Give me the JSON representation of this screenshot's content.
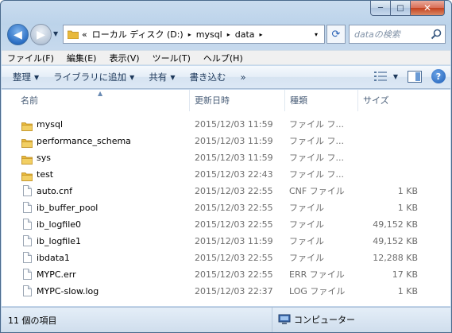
{
  "window": {
    "caption_buttons": {
      "minimize": "─",
      "maximize": "□",
      "close": "✕"
    }
  },
  "address": {
    "prefix": "«",
    "crumbs": [
      "ローカル ディスク (D:)",
      "mysql",
      "data"
    ],
    "separator": "▸",
    "dropdown": "▾",
    "refresh_icon": "refresh-icon"
  },
  "search": {
    "placeholder": "dataの検索"
  },
  "menu": [
    "ファイル(F)",
    "編集(E)",
    "表示(V)",
    "ツール(T)",
    "ヘルプ(H)"
  ],
  "commands": {
    "organize": "整理",
    "add_to_library": "ライブラリに追加",
    "share": "共有",
    "burn": "書き込む",
    "more": "»"
  },
  "columns": {
    "name": "名前",
    "date": "更新日時",
    "type": "種類",
    "size": "サイズ"
  },
  "files": [
    {
      "kind": "folder",
      "name": "mysql",
      "date": "2015/12/03 11:59",
      "type": "ファイル フ...",
      "size": ""
    },
    {
      "kind": "folder",
      "name": "performance_schema",
      "date": "2015/12/03 11:59",
      "type": "ファイル フ...",
      "size": ""
    },
    {
      "kind": "folder",
      "name": "sys",
      "date": "2015/12/03 11:59",
      "type": "ファイル フ...",
      "size": ""
    },
    {
      "kind": "folder",
      "name": "test",
      "date": "2015/12/03 22:43",
      "type": "ファイル フ...",
      "size": ""
    },
    {
      "kind": "file",
      "name": "auto.cnf",
      "date": "2015/12/03 22:55",
      "type": "CNF ファイル",
      "size": "1 KB"
    },
    {
      "kind": "file",
      "name": "ib_buffer_pool",
      "date": "2015/12/03 22:55",
      "type": "ファイル",
      "size": "1 KB"
    },
    {
      "kind": "file",
      "name": "ib_logfile0",
      "date": "2015/12/03 22:55",
      "type": "ファイル",
      "size": "49,152 KB"
    },
    {
      "kind": "file",
      "name": "ib_logfile1",
      "date": "2015/12/03 11:59",
      "type": "ファイル",
      "size": "49,152 KB"
    },
    {
      "kind": "file",
      "name": "ibdata1",
      "date": "2015/12/03 22:55",
      "type": "ファイル",
      "size": "12,288 KB"
    },
    {
      "kind": "file",
      "name": "MYPC.err",
      "date": "2015/12/03 22:55",
      "type": "ERR ファイル",
      "size": "17 KB"
    },
    {
      "kind": "file",
      "name": "MYPC-slow.log",
      "date": "2015/12/03 22:37",
      "type": "LOG ファイル",
      "size": "1 KB"
    }
  ],
  "status": {
    "item_count": "11 個の項目",
    "location": "コンピューター"
  },
  "colors": {
    "folder": "#e8b93c",
    "accent": "#1e395b",
    "muted_text": "#6d6d6d"
  }
}
